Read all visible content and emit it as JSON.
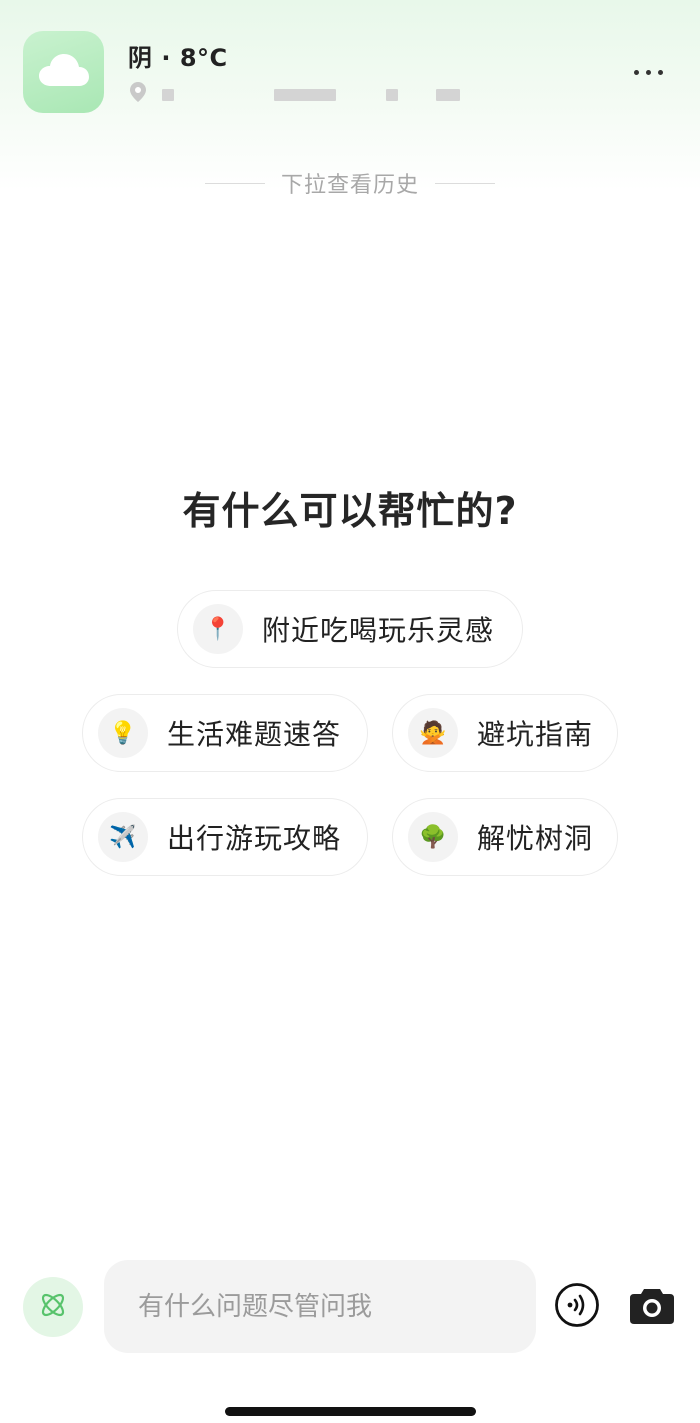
{
  "header": {
    "weather_text": "阴 · 8°C",
    "weather_icon": "cloud-icon",
    "location_icon": "location-pin-icon",
    "location_redacted": true,
    "more_icon": "more-icon"
  },
  "history_hint": "下拉查看历史",
  "greeting": "有什么可以帮忙的?",
  "suggestions": [
    {
      "icon": "📍",
      "icon_name": "pin-icon",
      "label": "附近吃喝玩乐灵感"
    },
    {
      "icon": "💡",
      "icon_name": "lightbulb-icon",
      "label": "生活难题速答"
    },
    {
      "icon": "🙅",
      "icon_name": "gesture-no-icon",
      "label": "避坑指南"
    },
    {
      "icon": "✈️",
      "icon_name": "airplane-icon",
      "label": "出行游玩攻略"
    },
    {
      "icon": "🌳",
      "icon_name": "tree-icon",
      "label": "解忧树洞"
    }
  ],
  "input": {
    "placeholder": "有什么问题尽管问我",
    "value": ""
  },
  "colors": {
    "brand_green": "#a9e7b4",
    "assistant_bg": "#e3f6e5",
    "chip_border": "#ececec",
    "input_bg": "#f3f3f3"
  }
}
